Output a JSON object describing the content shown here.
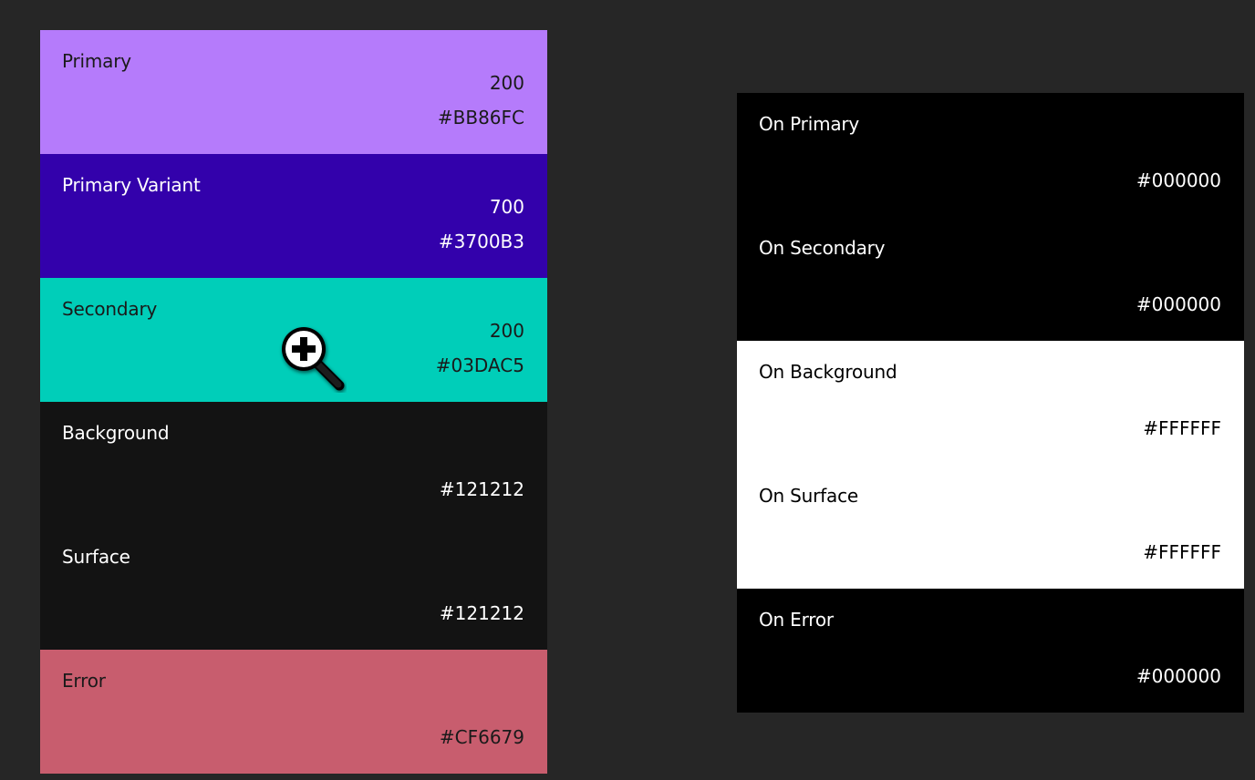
{
  "left_swatches": [
    {
      "name": "Primary",
      "tone": "200",
      "hex": "#BB86FC",
      "bg": "#b57bfb",
      "fg": "#1a1a1a"
    },
    {
      "name": "Primary Variant",
      "tone": "700",
      "hex": "#3700B3",
      "bg": "#3301ab",
      "fg": "#ffffff"
    },
    {
      "name": "Secondary",
      "tone": "200",
      "hex": "#03DAC5",
      "bg": "#00ceb9",
      "fg": "#1a1a1a"
    },
    {
      "name": "Background",
      "tone": "",
      "hex": "#121212",
      "bg": "#131313",
      "fg": "#ffffff"
    },
    {
      "name": "Surface",
      "tone": "",
      "hex": "#121212",
      "bg": "#131313",
      "fg": "#ffffff"
    },
    {
      "name": "Error",
      "tone": "",
      "hex": "#CF6679",
      "bg": "#c85d6e",
      "fg": "#1a1a1a"
    }
  ],
  "right_swatches": [
    {
      "name": "On Primary",
      "hex": "#000000",
      "bg": "#000000",
      "fg": "#ffffff"
    },
    {
      "name": "On Secondary",
      "hex": "#000000",
      "bg": "#000000",
      "fg": "#ffffff"
    },
    {
      "name": "On Background",
      "hex": "#FFFFFF",
      "bg": "#ffffff",
      "fg": "#000000"
    },
    {
      "name": "On Surface",
      "hex": "#FFFFFF",
      "bg": "#ffffff",
      "fg": "#000000"
    },
    {
      "name": "On Error",
      "hex": "#000000",
      "bg": "#000000",
      "fg": "#ffffff"
    }
  ],
  "cursor": {
    "icon": "zoom-in-magnifier-icon"
  }
}
